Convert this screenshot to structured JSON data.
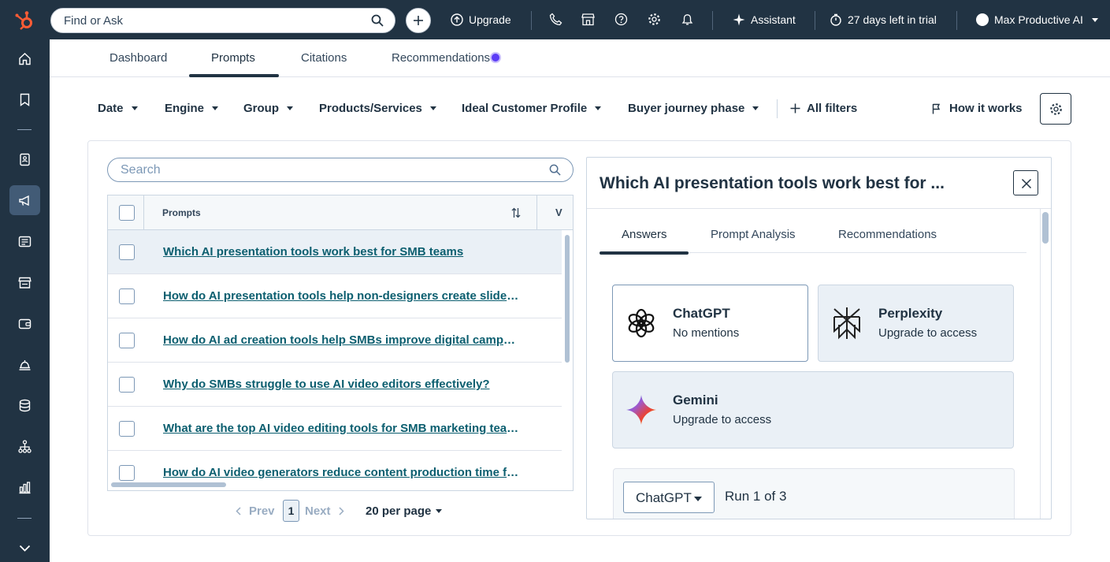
{
  "topbar": {
    "search_placeholder": "Find or Ask",
    "upgrade_label": "Upgrade",
    "assistant_label": "Assistant",
    "trial_label": "27 days left in trial",
    "account_label": "Max Productive AI"
  },
  "tabs": {
    "dashboard": "Dashboard",
    "prompts": "Prompts",
    "citations": "Citations",
    "recommendations": "Recommendations"
  },
  "filters": {
    "date": "Date",
    "engine": "Engine",
    "group": "Group",
    "products": "Products/Services",
    "icp": "Ideal Customer Profile",
    "buyer_phase": "Buyer journey phase",
    "all_filters": "All filters",
    "how_it_works": "How it works"
  },
  "list": {
    "search_placeholder": "Search",
    "column_prompts": "Prompts",
    "column_next": "V",
    "rows": [
      {
        "text": "Which AI presentation tools work best for SMB teams"
      },
      {
        "text": "How do AI presentation tools help non-designers create slides quickly?"
      },
      {
        "text": "How do AI ad creation tools help SMBs improve digital campaigns?"
      },
      {
        "text": "Why do SMBs struggle to use AI video editors effectively?"
      },
      {
        "text": "What are the top AI video editing tools for SMB marketing teams?"
      },
      {
        "text": "How do AI video generators reduce content production time for SMBs?"
      }
    ]
  },
  "pagination": {
    "prev": "Prev",
    "page": "1",
    "next": "Next",
    "per_page": "20 per page"
  },
  "detail": {
    "title": "Which AI presentation tools work best for ...",
    "tabs": {
      "answers": "Answers",
      "prompt_analysis": "Prompt Analysis",
      "recommendations": "Recommendations"
    },
    "engines": [
      {
        "name": "ChatGPT",
        "status": "No mentions"
      },
      {
        "name": "Perplexity",
        "status": "Upgrade to access"
      },
      {
        "name": "Gemini",
        "status": "Upgrade to access"
      }
    ],
    "run_select": "ChatGPT",
    "run_label": "Run 1 of 3"
  },
  "colors": {
    "nav_bg": "#213343",
    "link": "#0b5e6f",
    "brand": "#ff5c35",
    "notification_dot": "#5c3cf6"
  }
}
